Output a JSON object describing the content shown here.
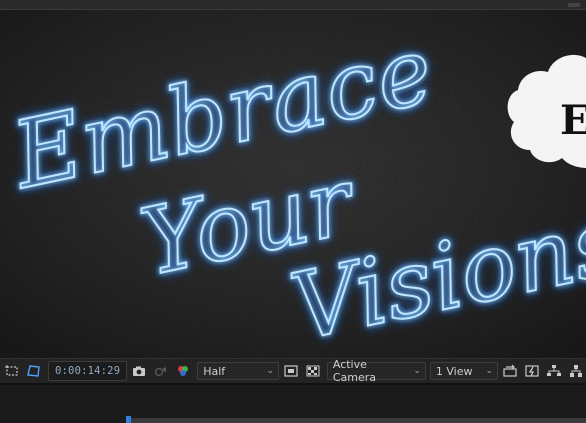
{
  "viewer": {
    "artwork_text": {
      "line1": "Embrace",
      "line2": "Your",
      "line3": "Visions"
    },
    "badge_text": "E",
    "neon_color": "#6ec8ff",
    "neon_glow_color": "#2f7fff",
    "background_color": "#101010"
  },
  "toolbar": {
    "timecode": "0:00:14:29",
    "resolution": "Half",
    "camera": "Active Camera",
    "views": "1 View"
  },
  "icons": {
    "region": "region-of-interest-icon",
    "mask": "mask-path-icon",
    "snapshot": "camera-snapshot-icon",
    "show_snapshot": "show-snapshot-icon",
    "color_channels": "color-channels-icon",
    "fast_preview": "fast-preview-icon",
    "transparency_grid": "transparency-grid-icon",
    "reset_exposure": "reset-exposure-icon",
    "flowchart": "flowchart-icon"
  }
}
